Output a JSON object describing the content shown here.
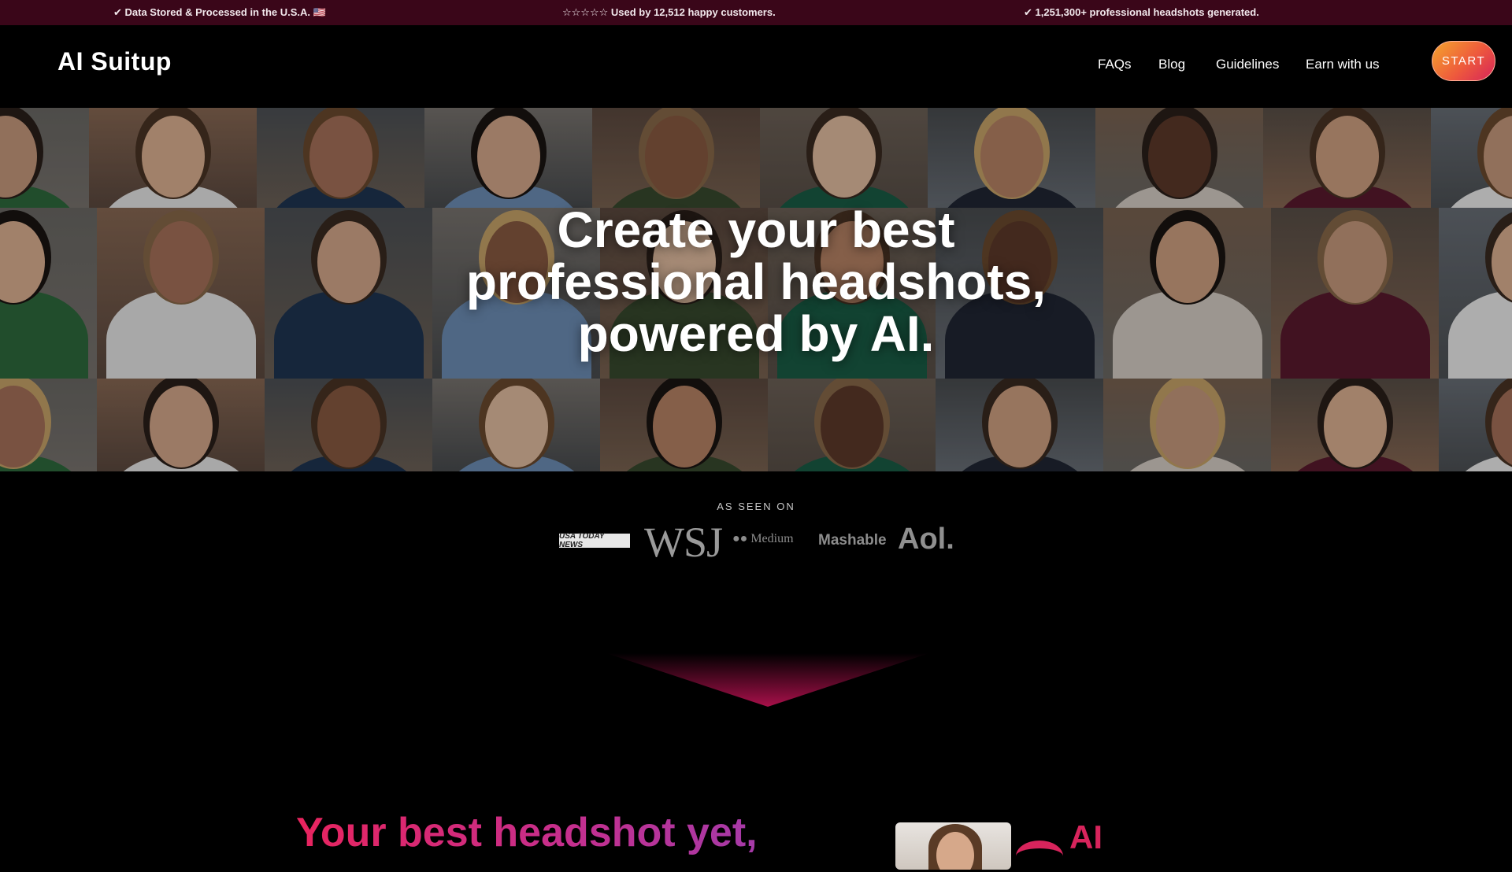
{
  "topbar": {
    "item1": "✔ Data Stored & Processed in the U.S.A. 🇺🇸",
    "item2": "☆☆☆☆☆ Used by 12,512 happy customers.",
    "item3": "✔ 1,251,300+ professional headshots generated."
  },
  "nav": {
    "logo": "AI Suitup",
    "links": [
      "FAQs",
      "Blog",
      "Guidelines",
      "Earn with us"
    ],
    "start_label": "START"
  },
  "hero": {
    "title_line1": "Create your best",
    "title_line2": "professional headshots,",
    "title_line3": "powered by AI."
  },
  "press": {
    "heading": "AS SEEN ON",
    "logos": [
      "USA TODAY NEWS",
      "WSJ",
      "Medium",
      "Mashable",
      "Aol."
    ]
  },
  "section": {
    "title": "Your best headshot yet,",
    "side_text": "AI"
  },
  "colors": {
    "topbar_bg": "#3a0619",
    "accent": "#d8245c",
    "start_gradient": [
      "#f4a52d",
      "#ee5a3c",
      "#d6245a"
    ]
  }
}
